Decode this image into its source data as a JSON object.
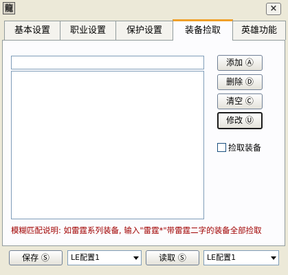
{
  "titlebar": {
    "close_label": "×"
  },
  "tabs": [
    {
      "label": "基本设置"
    },
    {
      "label": "职业设置"
    },
    {
      "label": "保护设置"
    },
    {
      "label": "装备捡取"
    },
    {
      "label": "英雄功能"
    }
  ],
  "item_pickup": {
    "name_input": {
      "value": ""
    },
    "buttons": {
      "add": "添加 Ⓐ",
      "delete": "删除 Ⓓ",
      "clear": "清空 Ⓒ",
      "modify": "修改 Ⓤ"
    },
    "pickup_checkbox": {
      "label": "捡取装备",
      "checked": false
    },
    "hint": "模糊匹配说明: 如雷霆系列装备, 输入\"雷霆*\"带雷霆二字的装备全部捡取"
  },
  "bottom_bar": {
    "save_label": "保存 Ⓢ",
    "save_config": "LE配置1",
    "read_label": "读取 Ⓢ",
    "read_config": "LE配置1"
  }
}
